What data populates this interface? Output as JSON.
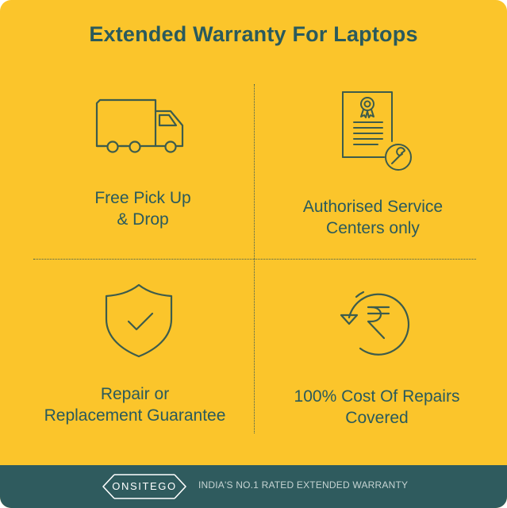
{
  "title": "Extended Warranty For Laptops",
  "features": [
    {
      "label": "Free Pick Up\n& Drop",
      "icon": "truck-icon"
    },
    {
      "label": "Authorised Service\nCenters only",
      "icon": "certificate-wrench-icon"
    },
    {
      "label": "Repair or\nReplacement Guarantee",
      "icon": "shield-check-icon"
    },
    {
      "label": "100% Cost Of Repairs\nCovered",
      "icon": "rupee-refresh-icon"
    }
  ],
  "footer": {
    "logo": "ONSITEGO",
    "tagline": "INDIA'S NO.1 RATED EXTENDED WARRANTY"
  },
  "colors": {
    "background": "#fbc52b",
    "text": "#2a5a5c",
    "icon_stroke": "#3d5c4c",
    "footer": "#2f5b5e"
  }
}
